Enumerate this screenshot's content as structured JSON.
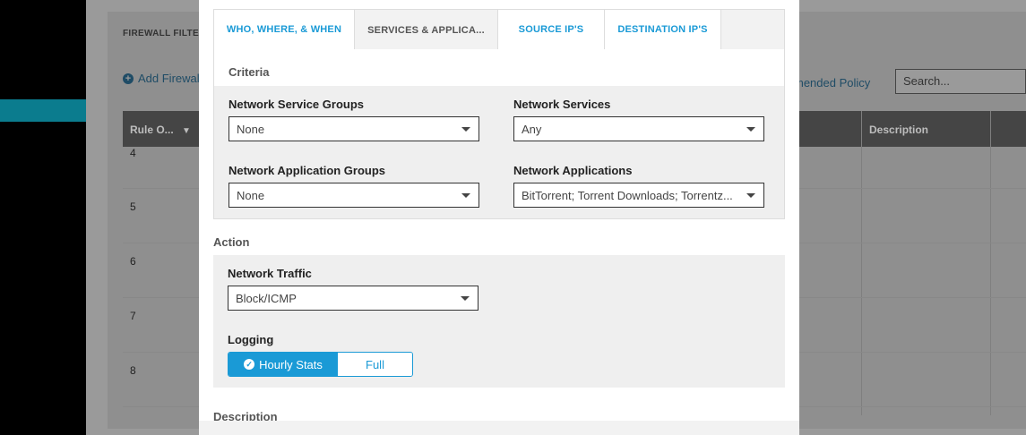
{
  "background": {
    "title": "FIREWALL FILTE",
    "add_link": "Add Firewal",
    "recommended_link": "mended Policy",
    "search_placeholder": "Search...",
    "table": {
      "col_rule": "Rule O...",
      "col_description": "Description",
      "rows": [
        "4",
        "5",
        "6",
        "7",
        "8"
      ]
    }
  },
  "tabs": [
    {
      "label": "WHO, WHERE, & WHEN",
      "active": false
    },
    {
      "label": "SERVICES & APPLICA...",
      "active": true
    },
    {
      "label": "SOURCE IP'S",
      "active": false
    },
    {
      "label": "DESTINATION IP'S",
      "active": false
    }
  ],
  "criteria": {
    "heading": "Criteria",
    "network_service_groups": {
      "label": "Network Service Groups",
      "value": "None"
    },
    "network_services": {
      "label": "Network Services",
      "value": "Any"
    },
    "network_application_groups": {
      "label": "Network Application Groups",
      "value": "None"
    },
    "network_applications": {
      "label": "Network Applications",
      "value": "BitTorrent; Torrent Downloads; Torrentz..."
    }
  },
  "action": {
    "heading": "Action",
    "network_traffic": {
      "label": "Network Traffic",
      "value": "Block/ICMP"
    },
    "logging": {
      "label": "Logging",
      "options": [
        "Hourly Stats",
        "Full"
      ],
      "selected": "Hourly Stats"
    }
  },
  "description_heading": "Description",
  "colors": {
    "accent": "#1a9ad6",
    "overlay": "#9a9a9a"
  }
}
